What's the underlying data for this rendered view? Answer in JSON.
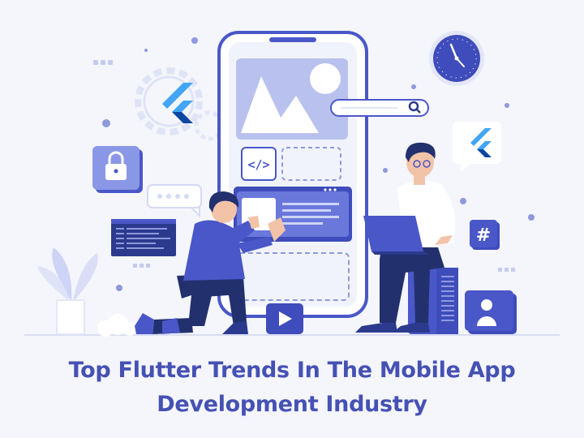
{
  "title": {
    "line1": "Top Flutter Trends In The Mobile App",
    "line2": "Development Industry"
  },
  "icons": {
    "code_symbol": "</>",
    "hashtag_symbol": "#"
  },
  "colors": {
    "title": "#4651b4",
    "accent_blue": "#4a57c8",
    "light_blue": "#cdd4f5",
    "background": "#f4f6fc",
    "flutter_light": "#42a5f5",
    "flutter_dark": "#0d47a1"
  }
}
